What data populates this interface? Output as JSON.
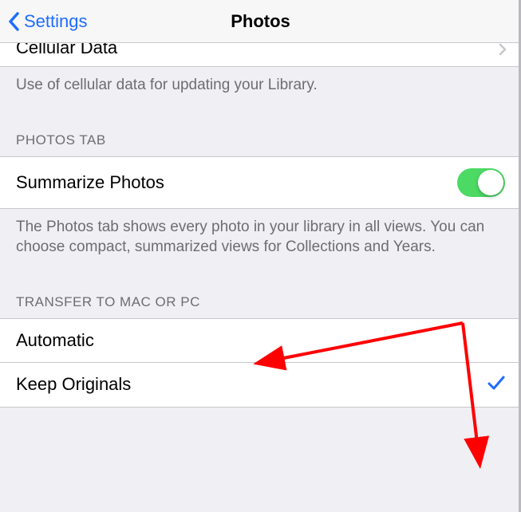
{
  "nav": {
    "back_label": "Settings",
    "title": "Photos"
  },
  "cellular_row": {
    "label": "Cellular Data"
  },
  "cellular_footer": "Use of cellular data for updating your Library.",
  "photos_tab": {
    "header": "PHOTOS TAB",
    "summarize_label": "Summarize Photos",
    "summarize_on": true,
    "footer": "The Photos tab shows every photo in your library in all views. You can choose compact, summarized views for Collections and Years."
  },
  "transfer": {
    "header": "TRANSFER TO MAC OR PC",
    "options": [
      {
        "label": "Automatic",
        "selected": false
      },
      {
        "label": "Keep Originals",
        "selected": true
      }
    ]
  },
  "colors": {
    "accent": "#1f6cff",
    "toggle_on": "#4cd964",
    "annotation": "#ff0000"
  }
}
